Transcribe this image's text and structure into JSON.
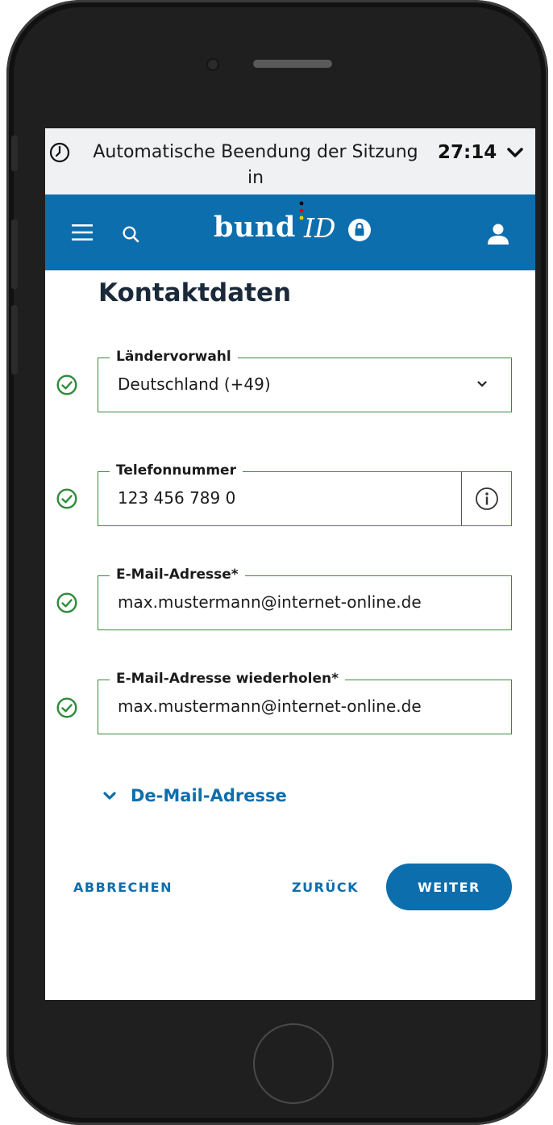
{
  "session": {
    "message": "Automatische Beendung der Sitzung in",
    "timer": "27:14"
  },
  "header": {
    "logo_main": "bund",
    "logo_id": "ID"
  },
  "page": {
    "title": "Kontaktdaten"
  },
  "form": {
    "country_code": {
      "label": "Ländervorwahl",
      "value": "Deutschland (+49)"
    },
    "phone": {
      "label": "Telefonnummer",
      "value": "123 456 789 0"
    },
    "email": {
      "label": "E-Mail-Adresse*",
      "value": "max.mustermann@internet-online.de"
    },
    "email_repeat": {
      "label": "E-Mail-Adresse wiederholen*",
      "value": "max.mustermann@internet-online.de"
    },
    "demail_toggle": "De-Mail-Adresse"
  },
  "actions": {
    "cancel": "ABBRECHEN",
    "back": "ZURÜCK",
    "next": "WEITER"
  },
  "colors": {
    "brand_blue": "#0d6ead",
    "success_green": "#2e8b3a",
    "session_bar_bg": "#f0f1f2"
  }
}
